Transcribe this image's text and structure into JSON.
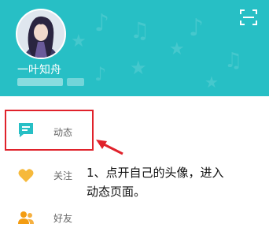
{
  "profile": {
    "username": "一叶知舟",
    "avatar_alt": "avatar",
    "scan_icon": "scan-icon"
  },
  "menu": {
    "items": [
      {
        "label": "动态",
        "icon": "chat-bubble-icon",
        "color": "#27bfc5"
      },
      {
        "label": "关注",
        "icon": "heart-icon",
        "color": "#f6b93b"
      },
      {
        "label": "好友",
        "icon": "friends-icon",
        "color": "#f39c12"
      }
    ]
  },
  "annotation": {
    "line1": "1、点开自己的头像，进入",
    "line2": "动态页面。"
  },
  "colors": {
    "header": "#27bfc5",
    "highlight": "#e0222b"
  }
}
